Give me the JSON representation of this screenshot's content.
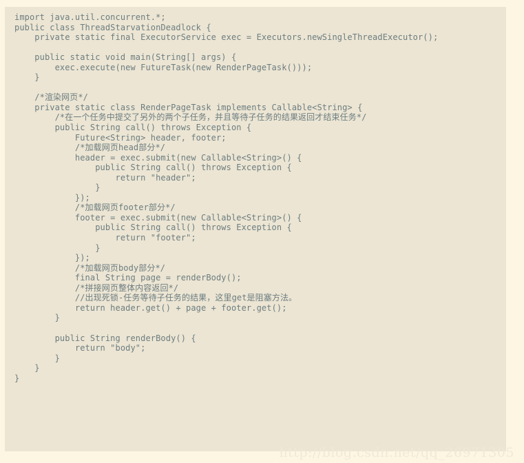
{
  "document": {
    "kind": "code-snippet",
    "language": "Java",
    "background_color": "#fdf6e3",
    "code_block_color": "#ece5d3",
    "text_color": "#6c7d80",
    "watermark_color": "#efe9d8"
  },
  "code": {
    "lines": [
      "import java.util.concurrent.*;",
      "public class ThreadStarvationDeadlock {",
      "    private static final ExecutorService exec = Executors.newSingleThreadExecutor();",
      "",
      "    public static void main(String[] args) {",
      "        exec.execute(new FutureTask(new RenderPageTask()));",
      "    }",
      "",
      "    /*渲染网页*/",
      "    private static class RenderPageTask implements Callable<String> {",
      "        /*在一个任务中提交了另外的两个子任务，并且等待子任务的结果返回才结束任务*/",
      "        public String call() throws Exception {",
      "            Future<String> header, footer;",
      "            /*加载网页head部分*/",
      "            header = exec.submit(new Callable<String>() {",
      "                public String call() throws Exception {",
      "                    return \"header\";",
      "                }",
      "            });",
      "            /*加载网页footer部分*/",
      "            footer = exec.submit(new Callable<String>() {",
      "                public String call() throws Exception {",
      "                    return \"footer\";",
      "                }",
      "            });",
      "            /*加载网页body部分*/",
      "            final String page = renderBody();",
      "            /*拼接网页整体内容返回*/",
      "            //出现死锁-任务等待子任务的结果，这里get是阻塞方法。",
      "            return header.get() + page + footer.get();",
      "        }",
      "",
      "        public String renderBody() {",
      "            return \"body\";",
      "        }",
      "    }",
      "}"
    ]
  },
  "watermark": {
    "text": "http://blog.csdn.net/qq_26971305"
  }
}
